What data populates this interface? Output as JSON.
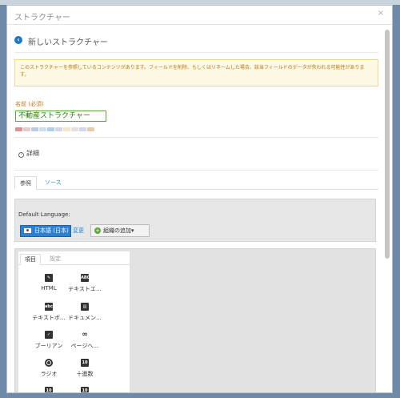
{
  "modal": {
    "title": "ストラクチャー",
    "close": "×"
  },
  "header": {
    "back_icon": "arrow-left-icon",
    "page_title": "新しいストラクチャー"
  },
  "warning": "このストラクチャーを参照しているコンテンツがあります。フィールドを削除、もしくはリネームした場合、該当フィールドのデータが失われる可能性があります。",
  "name": {
    "label": "名前 (必須)",
    "value": "不動産ストラクチャー"
  },
  "details": "詳細",
  "tabs": [
    "参照",
    "ソース"
  ],
  "language": {
    "label": "Default Language:",
    "selected": "日本語 (日本)",
    "change": "変更",
    "add_org": "組織の追加▾"
  },
  "fields_tabs": [
    "項目",
    "設定"
  ],
  "fields": [
    {
      "label": "HTML",
      "icon": "pencil-icon",
      "glyph": "✎"
    },
    {
      "label": "テキストエ…",
      "icon": "text-area-icon",
      "glyph": "ABC"
    },
    {
      "label": "テキストボ…",
      "icon": "text-box-icon",
      "glyph": "abc"
    },
    {
      "label": "ドキュメン…",
      "icon": "document-icon",
      "glyph": "▤"
    },
    {
      "label": "ブーリアン",
      "icon": "checkbox-icon",
      "glyph": "✓"
    },
    {
      "label": "ページへ…",
      "icon": "link-icon",
      "glyph": "∞"
    },
    {
      "label": "ラジオ",
      "icon": "radio-icon",
      "glyph": ""
    },
    {
      "label": "十進数",
      "icon": "decimal-icon",
      "glyph": "10"
    },
    {
      "label": "",
      "icon": "integer-icon",
      "glyph": "10"
    },
    {
      "label": "",
      "icon": "number-icon",
      "glyph": "10"
    }
  ]
}
